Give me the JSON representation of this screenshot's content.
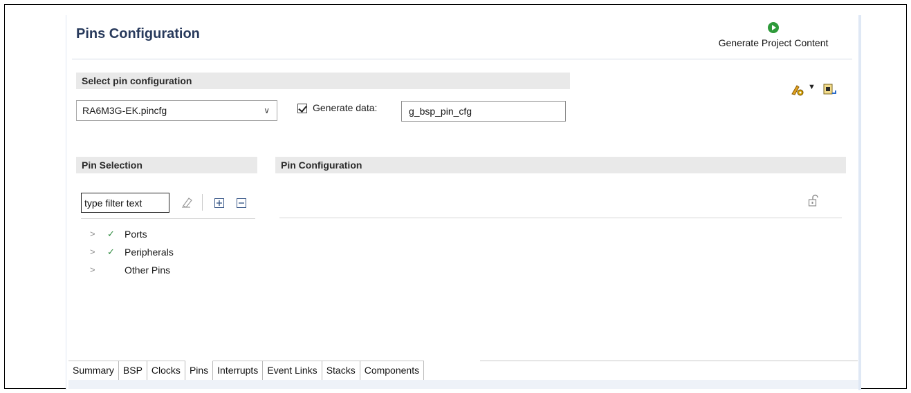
{
  "editor": {
    "title": "Pins Configuration",
    "generate_button": "Generate Project Content"
  },
  "select_config": {
    "section_label": "Select pin configuration",
    "selected_file": "RA6M3G-EK.pincfg",
    "generate_data_label": "Generate data:",
    "generate_data_checked": true,
    "generate_data_value": "g_bsp_pin_cfg"
  },
  "pin_selection": {
    "section_label": "Pin Selection",
    "filter_placeholder": "type filter text",
    "tree": [
      {
        "label": "Ports",
        "checked": true
      },
      {
        "label": "Peripherals",
        "checked": true
      },
      {
        "label": "Other Pins",
        "checked": false
      }
    ]
  },
  "pin_configuration": {
    "section_label": "Pin Configuration"
  },
  "tabs": [
    "Summary",
    "BSP",
    "Clocks",
    "Pins",
    "Interrupts",
    "Event Links",
    "Stacks",
    "Components"
  ],
  "active_tab": "Pins",
  "icons": {
    "generate": "run-icon",
    "toolbar": [
      "configure-icon",
      "dropdown-arrow-icon",
      "export-icon"
    ],
    "filter": [
      "clear-filter-icon",
      "expand-all-icon",
      "collapse-all-icon"
    ],
    "lock": "unlock-icon"
  },
  "colors": {
    "title": "#283a5c",
    "section_bg": "#e9e9e9",
    "check_green": "#2f8a3f",
    "run_green": "#2e9a3a"
  }
}
